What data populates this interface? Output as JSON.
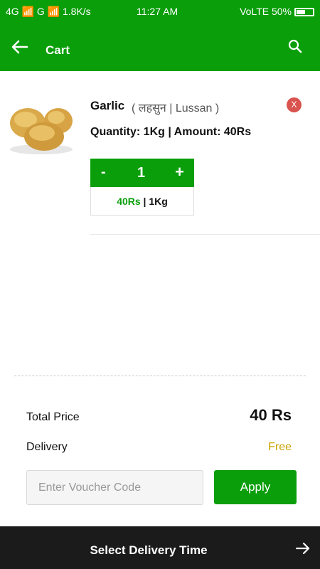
{
  "status_bar": {
    "left": "4G 📶 G 📶 1.8K/s",
    "time": "11:27 AM",
    "right": "VoLTE 50%"
  },
  "app_bar": {
    "title": "Cart",
    "back_icon": "arrow-left-icon",
    "search_icon": "search-icon"
  },
  "cart_item": {
    "name": "Garlic",
    "alt_name": "( लहसुन | Lussan )",
    "quantity_line": "Quantity: 1Kg  |  Amount: 40Rs",
    "remove_label": "X",
    "stepper": {
      "minus": "-",
      "value": "1",
      "plus": "+"
    },
    "price": "40Rs",
    "unit": " | 1Kg"
  },
  "summary": {
    "total_label": "Total Price",
    "total_value": "40 Rs",
    "delivery_label": "Delivery",
    "delivery_value": "Free"
  },
  "voucher": {
    "placeholder": "Enter Voucher Code",
    "value": "",
    "apply_label": "Apply"
  },
  "bottom_bar": {
    "label": "Select Delivery Time",
    "icon": "arrow-right-icon"
  },
  "colors": {
    "primary": "#0a9e0a",
    "remove": "#d9534f",
    "delivery_free": "#c9a200",
    "bottom_bar": "#1b1b1b"
  }
}
